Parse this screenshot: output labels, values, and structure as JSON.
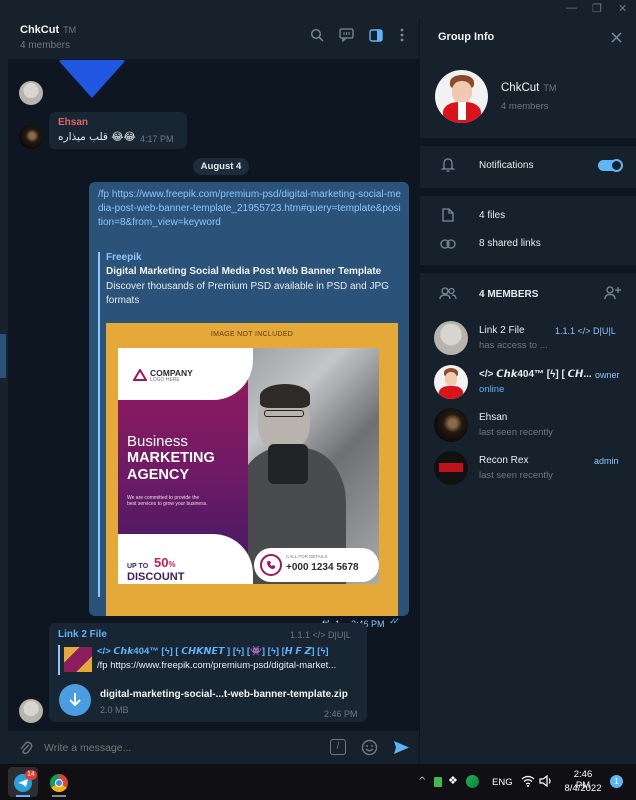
{
  "window": {
    "title": "ChkCut",
    "trademark": "TM",
    "subtitle": "4 members",
    "controls": [
      "—",
      "❐",
      "✕"
    ]
  },
  "header_icons": [
    "search-icon",
    "comments-icon",
    "sidebar-toggle-icon",
    "more-icon"
  ],
  "messages": {
    "ehsan": {
      "sender": "Ehsan",
      "text": "قلب میذاره 😂😂",
      "time": "4:17 PM",
      "sender_color": "#e06666"
    },
    "date_separator": "August 4",
    "outgoing": {
      "url_text": "/fp https://www.freepik.com/premium-psd/digital-marketing-social-media-post-web-banner-template_21955723.htm#query=template&position=8&from_view=keyword",
      "preview_site": "Freepik",
      "preview_title": "Digital Marketing Social Media Post Web Banner Template",
      "preview_desc": "Discover thousands of Premium PSD available in PSD and JPG formats",
      "replies": "1",
      "time": "2:46 PM"
    },
    "banner": {
      "not_included": "IMAGE NOT INCLUDED",
      "company": "COMPANY",
      "company_sub": "LOGO HERE",
      "business": "Business",
      "marketing": "MARKETING",
      "agency": "AGENCY",
      "blurb": "We are committed to provide the best services to grow your business.",
      "up_to": "UP TO",
      "percent": "50",
      "percent_sign": "%",
      "discount": "DISCOUNT",
      "call": "CALL FOR DETAILS",
      "phone": "+000 1234 5678"
    },
    "link2file": {
      "sender": "Link 2 File",
      "badge": "1.1.1 </> D|U|L",
      "reply_title": "</> 𝘾𝙝𝙠404™ [ϟ] [ 𝘾𝙃𝙆𝙉𝙀𝙏 ] [ϟ] [👾] [ϟ] [𝙃 𝙁 𝙕] [ϟ]",
      "reply_text": "/fp https://www.freepik.com/premium-psd/digital-market...",
      "file_name": "digital-marketing-social-...t-web-banner-template.zip",
      "file_size": "2.0 MB",
      "time": "2:46 PM"
    }
  },
  "composer": {
    "placeholder": "Write a message..."
  },
  "group_info": {
    "title": "Group Info",
    "name": "ChkCut",
    "trademark": "TM",
    "members_count": "4 members",
    "notifications_label": "Notifications",
    "notifications_on": true,
    "files": "4 files",
    "shared_links": "8 shared links",
    "members_header": "4 MEMBERS",
    "members": [
      {
        "name": "Link 2 File",
        "status": "has access to ...",
        "tag": "1.1.1 </> D|U|L",
        "avatar": "light"
      },
      {
        "name": "</> 𝘾𝙝𝙠404™ [ϟ] [ 𝘾𝙃...",
        "status": "online",
        "tag": "owner",
        "avatar": "red"
      },
      {
        "name": "Ehsan",
        "status": "last seen recently",
        "tag": "",
        "avatar": "dark"
      },
      {
        "name": "Recon Rex",
        "status": "last seen recently",
        "tag": "admin",
        "avatar": "rr"
      }
    ]
  },
  "taskbar": {
    "telegram_badge": "14",
    "language": "ENG",
    "clock_time": "2:46 PM",
    "clock_date": "8/4/2022",
    "notification_count": "1"
  },
  "colors": {
    "accent": "#5eb5f7",
    "outgoing_bubble": "#2b5278",
    "incoming_bubble": "#182533",
    "panel": "#17212b",
    "chat_bg": "#0e1621"
  }
}
